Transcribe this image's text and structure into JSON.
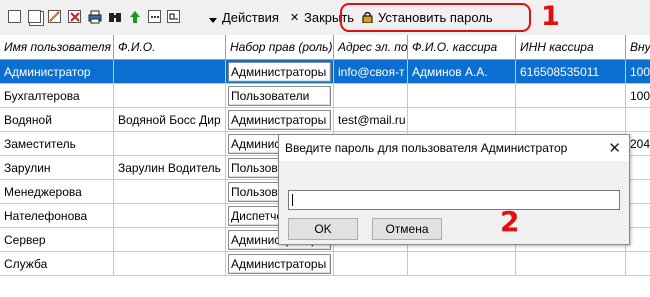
{
  "toolbar": {
    "icons": [
      "new-icon",
      "copy-icon",
      "edit-icon",
      "delete-icon",
      "print-icon",
      "binoculars-icon",
      "up-arrow-icon",
      "dots-icon",
      "window-icon",
      "dropdown-arrow-icon"
    ],
    "actions_label": "Действия",
    "close_label": "Закрыть",
    "set_password_label": "Установить пароль",
    "lock_icon": "lock-icon"
  },
  "annotations": {
    "marker1": "1",
    "marker2": "2",
    "color": "#e01010"
  },
  "table": {
    "headers": [
      "Имя пользователя",
      "Ф.И.О.",
      "Набор прав (роль)",
      "Адрес эл. почты",
      "Ф.И.О. кассира",
      "ИНН кассира",
      "Внутр"
    ],
    "rows": [
      [
        "Администратор",
        "",
        "Администраторы",
        "info@своя-т",
        "Админов А.А.",
        "616508535011",
        "100"
      ],
      [
        "Бухгалтерова",
        "",
        "Пользователи",
        "",
        "",
        "",
        "100"
      ],
      [
        "Водяной",
        "Водяной Босс Дир",
        "Администраторы",
        "test@mail.ru",
        "",
        "",
        ""
      ],
      [
        "Заместитель",
        "",
        "Администраторы",
        "",
        "",
        "",
        "204"
      ],
      [
        "Зарулин",
        "Зарулин Водитель",
        "Пользователи",
        "",
        "",
        "",
        ""
      ],
      [
        "Менеджерова",
        "",
        "Пользователи",
        "",
        "",
        "",
        ""
      ],
      [
        "Нателефонова",
        "",
        "Диспетчеры",
        "",
        "",
        "",
        ""
      ],
      [
        "Сервер",
        "",
        "Администраторы",
        "",
        "",
        "",
        ""
      ],
      [
        "Служба",
        "",
        "Администраторы",
        "",
        "",
        "",
        ""
      ]
    ],
    "selected_row": 0,
    "selection_color": "#0a6fd0"
  },
  "dialog": {
    "title": "Введите пароль для пользователя Администратор",
    "input_value": "",
    "ok_label": "OK",
    "cancel_label": "Отмена",
    "close_icon": "close-icon"
  }
}
